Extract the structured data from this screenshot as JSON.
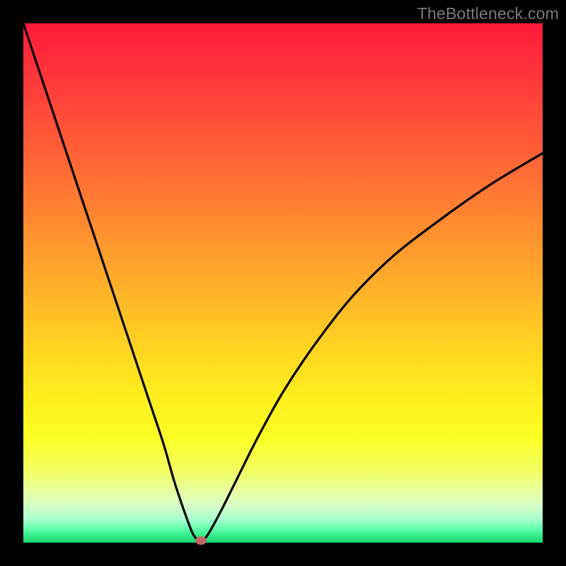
{
  "watermark": "TheBottleneck.com",
  "chart_data": {
    "type": "line",
    "title": "",
    "xlabel": "",
    "ylabel": "",
    "xlim": [
      0,
      100
    ],
    "ylim": [
      0,
      100
    ],
    "grid": false,
    "legend": false,
    "background_gradient": {
      "top": "#ff1a3a",
      "bottom": "#16d46e",
      "description": "vertical red-to-green rainbow heat gradient"
    },
    "series": [
      {
        "name": "curve",
        "color": "#000000",
        "x": [
          0,
          3,
          6,
          9,
          12,
          15,
          18,
          21,
          24,
          27,
          29,
          31,
          32.5,
          33.5,
          34,
          35.5,
          38,
          41,
          45,
          50,
          56,
          63,
          71,
          80,
          90,
          100
        ],
        "y": [
          100,
          91,
          82,
          73,
          64,
          55,
          46,
          37,
          28,
          19,
          12,
          6,
          2,
          0.5,
          0,
          1.5,
          6,
          12,
          20,
          29,
          38,
          47,
          55,
          62,
          69,
          75
        ]
      }
    ],
    "marker": {
      "name": "optimal-point",
      "color": "#c06868",
      "x": 34.2,
      "y": 0.4
    }
  },
  "layout": {
    "outer_size": 800,
    "inner_offset": 33,
    "inner_size": 734
  }
}
